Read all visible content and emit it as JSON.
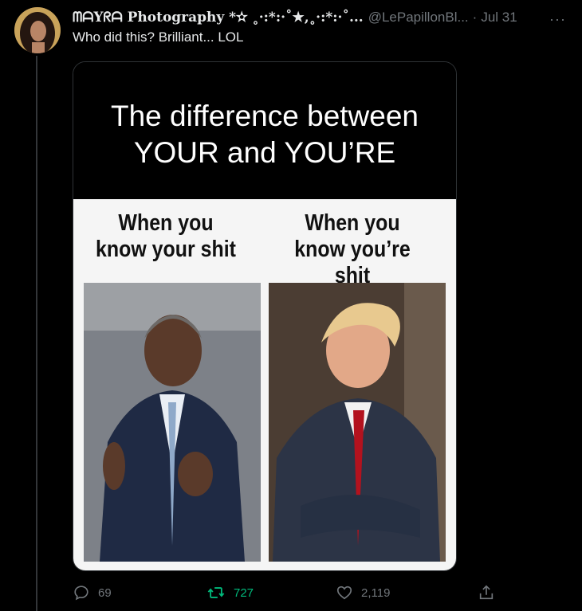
{
  "tweet": {
    "display_name": "ᗰᗩYᖇᗩ Photography *✫ ˳·:*:·˚★,˳·:*:·˚...",
    "handle": "@LePapillonBl...",
    "separator": "·",
    "time": "Jul 31",
    "more_label": "···",
    "text": "Who did this? Brilliant... LOL"
  },
  "meme": {
    "title_line1": "The difference between",
    "title_line2": "YOUR and YOU’RE",
    "left_caption_line1": "When you",
    "left_caption_line2": "know your shit",
    "right_caption_line1": "When you",
    "right_caption_line2": "know you’re shit"
  },
  "actions": {
    "reply_count": "69",
    "retweet_count": "727",
    "like_count": "2,119"
  },
  "colors": {
    "background": "#000000",
    "text": "#e7e9ea",
    "muted": "#71767b",
    "retweet_active": "#00ba7c"
  }
}
